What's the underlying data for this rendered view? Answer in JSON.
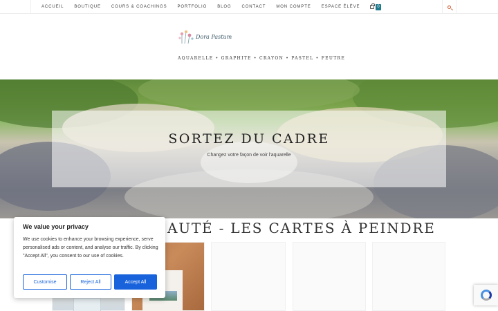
{
  "nav": {
    "items": [
      "ACCUEIL",
      "BOUTIQUE",
      "COURS & COACHINGS",
      "PORTFOLIO",
      "BLOG",
      "CONTACT",
      "MON COMPTE",
      "ESPACE ÉLÈVE"
    ],
    "cart_count": "0",
    "accent": "#1f7a8c"
  },
  "header": {
    "logo_text": "Dora Pastum",
    "tagline": "AQUARELLE • GRAPHITE • CRAYON • PASTEL • FEUTRE"
  },
  "hero": {
    "title": "SORTEZ DU CADRE",
    "subtitle": "Changez votre façon de voir l'aquarelle"
  },
  "section": {
    "title": "AUTÉ - LES CARTES À PEINDRE"
  },
  "cookie": {
    "title": "We value your privacy",
    "text": "We use cookies to enhance your browsing experience, serve personalised ads or content, and analyse our traffic. By clicking \"Accept All\", you consent to our use of cookies.",
    "customise": "Customise",
    "reject": "Reject All",
    "accept": "Accept All",
    "button_color": "#1863dc"
  },
  "icons": {
    "search": "search-icon",
    "cart": "cart-icon",
    "recaptcha": "recaptcha-icon"
  }
}
